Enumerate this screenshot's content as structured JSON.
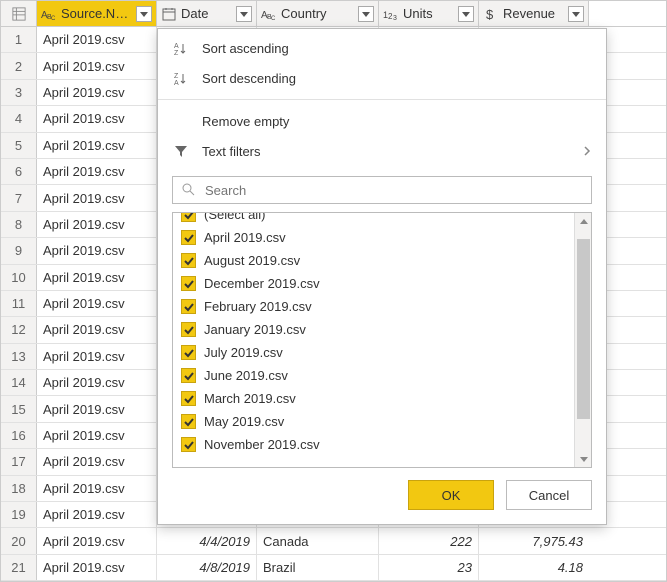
{
  "columns": {
    "source": {
      "label": "Source.Name",
      "type": "text"
    },
    "date": {
      "label": "Date",
      "type": "date"
    },
    "country": {
      "label": "Country",
      "type": "text"
    },
    "units": {
      "label": "Units",
      "type": "integer"
    },
    "revenue": {
      "label": "Revenue",
      "type": "currency"
    }
  },
  "rows": [
    {
      "n": "1",
      "source": "April 2019.csv",
      "date": "",
      "country": "",
      "units": "",
      "revenue": ""
    },
    {
      "n": "2",
      "source": "April 2019.csv",
      "date": "",
      "country": "",
      "units": "",
      "revenue": ""
    },
    {
      "n": "3",
      "source": "April 2019.csv",
      "date": "",
      "country": "",
      "units": "",
      "revenue": ""
    },
    {
      "n": "4",
      "source": "April 2019.csv",
      "date": "",
      "country": "",
      "units": "",
      "revenue": ""
    },
    {
      "n": "5",
      "source": "April 2019.csv",
      "date": "",
      "country": "",
      "units": "",
      "revenue": ""
    },
    {
      "n": "6",
      "source": "April 2019.csv",
      "date": "",
      "country": "",
      "units": "",
      "revenue": ""
    },
    {
      "n": "7",
      "source": "April 2019.csv",
      "date": "",
      "country": "",
      "units": "",
      "revenue": ""
    },
    {
      "n": "8",
      "source": "April 2019.csv",
      "date": "",
      "country": "",
      "units": "",
      "revenue": ""
    },
    {
      "n": "9",
      "source": "April 2019.csv",
      "date": "",
      "country": "",
      "units": "",
      "revenue": ""
    },
    {
      "n": "10",
      "source": "April 2019.csv",
      "date": "",
      "country": "",
      "units": "",
      "revenue": ""
    },
    {
      "n": "11",
      "source": "April 2019.csv",
      "date": "",
      "country": "",
      "units": "",
      "revenue": ""
    },
    {
      "n": "12",
      "source": "April 2019.csv",
      "date": "",
      "country": "",
      "units": "",
      "revenue": ""
    },
    {
      "n": "13",
      "source": "April 2019.csv",
      "date": "",
      "country": "",
      "units": "",
      "revenue": ""
    },
    {
      "n": "14",
      "source": "April 2019.csv",
      "date": "",
      "country": "",
      "units": "",
      "revenue": ""
    },
    {
      "n": "15",
      "source": "April 2019.csv",
      "date": "",
      "country": "",
      "units": "",
      "revenue": ""
    },
    {
      "n": "16",
      "source": "April 2019.csv",
      "date": "",
      "country": "",
      "units": "",
      "revenue": ""
    },
    {
      "n": "17",
      "source": "April 2019.csv",
      "date": "",
      "country": "",
      "units": "",
      "revenue": ""
    },
    {
      "n": "18",
      "source": "April 2019.csv",
      "date": "",
      "country": "",
      "units": "",
      "revenue": ""
    },
    {
      "n": "19",
      "source": "April 2019.csv",
      "date": "",
      "country": "",
      "units": "",
      "revenue": ""
    },
    {
      "n": "20",
      "source": "April 2019.csv",
      "date": "4/4/2019",
      "country": "Canada",
      "units": "222",
      "revenue": "7,975.43"
    },
    {
      "n": "21",
      "source": "April 2019.csv",
      "date": "4/8/2019",
      "country": "Brazil",
      "units": "23",
      "revenue": "4.18"
    }
  ],
  "filter_menu": {
    "sort_asc": "Sort ascending",
    "sort_desc": "Sort descending",
    "remove_empty": "Remove empty",
    "text_filters": "Text filters",
    "search_placeholder": "Search",
    "values": [
      "(Select all)",
      "April 2019.csv",
      "August 2019.csv",
      "December 2019.csv",
      "February 2019.csv",
      "January 2019.csv",
      "July 2019.csv",
      "June 2019.csv",
      "March 2019.csv",
      "May 2019.csv",
      "November 2019.csv"
    ],
    "ok": "OK",
    "cancel": "Cancel"
  }
}
